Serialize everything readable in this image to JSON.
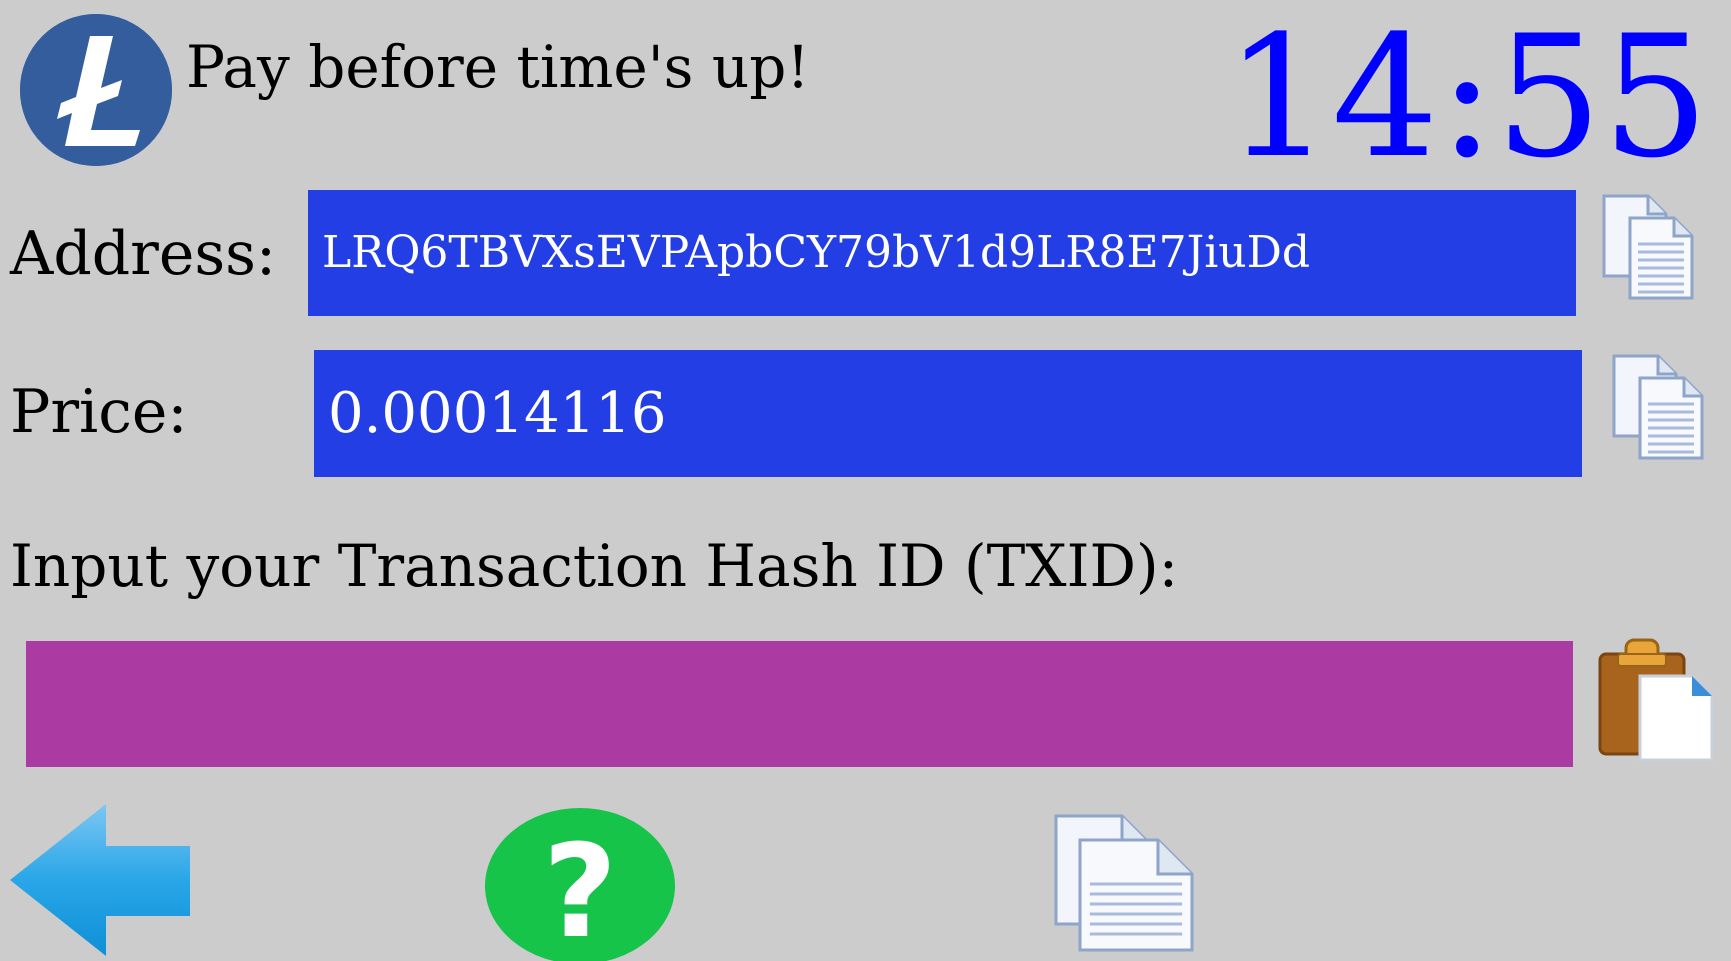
{
  "header": {
    "logo_icon": "litecoin-logo-icon",
    "message": "Pay before time's up!",
    "timer": "14:55"
  },
  "colors": {
    "background": "#cccccc",
    "value_box": "#233ee4",
    "txid_input": "#ab3aa3",
    "timer": "#0000ff",
    "help_button": "#16c44a",
    "back_arrow": "#1aa3e8"
  },
  "address": {
    "label": "Address:",
    "value": "LRQ6TBVXsEVPApbCY79bV1d9LR8E7JiuDd",
    "copy_icon": "copy-icon"
  },
  "price": {
    "label": "Price:",
    "value": "0.00014116",
    "copy_icon": "copy-icon"
  },
  "txid": {
    "label": "Input your Transaction Hash ID (TXID):",
    "value": "",
    "placeholder": "",
    "paste_icon": "paste-icon"
  },
  "footer": {
    "back_icon": "back-arrow-icon",
    "help_icon": "help-icon",
    "copy_all_icon": "copy-icon"
  }
}
